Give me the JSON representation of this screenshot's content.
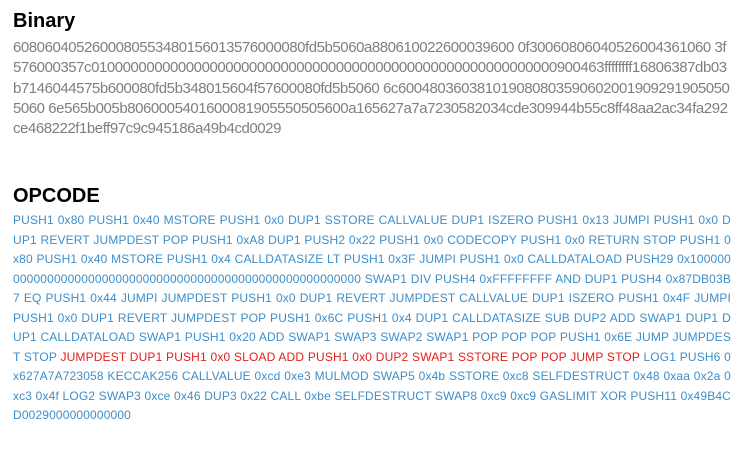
{
  "binary": {
    "heading": "Binary",
    "hex": "6080604052600080553480156013576000080fd5b5060a880610022600039600 0f30060806040526004361060 3f576000357c01000000000000000000000000000000000000000000000000000000000900463ffffffff16806387db03b7146044575b600080fd5b348015604f57600080fd5b5060 6c6004803603810190808035906020019092919050505060 6e565b005b8060005401600081905550505600a165627a7a7230582034cde309944b55c8ff48aa2ac34fa292ce468222f1beff97c9c945186a49b4cd0029"
  },
  "opcode": {
    "heading": "OPCODE",
    "segments": [
      {
        "style": "normal",
        "text": "PUSH1 0x80 PUSH1 0x40 MSTORE PUSH1 0x0 DUP1 SSTORE CALLVALUE DUP1 ISZERO PUSH1 0x13 JUMPI PUSH1 0x0 DUP1 REVERT JUMPDEST POP PUSH1 0xA8 DUP1 PUSH2 0x22 PUSH1 0x0 CODECOPY PUSH1 0x0 RETURN STOP PUSH1 0x80 PUSH1 0x40 MSTORE PUSH1 0x4 CALLDATASIZE LT PUSH1 0x3F JUMPI PUSH1 0x0 CALLDATALOAD PUSH29 0x100000000000000000000000000000000000000000000000000000000 SWAP1 DIV PUSH4 0xFFFFFFFF AND DUP1 PUSH4 0x87DB03B7 EQ PUSH1 0x44 JUMPI JUMPDEST PUSH1 0x0 DUP1 REVERT JUMPDEST CALLVALUE DUP1 ISZERO PUSH1 0x4F JUMPI PUSH1 0x0 DUP1 REVERT JUMPDEST POP PUSH1 0x6C PUSH1 0x4 DUP1 CALLDATASIZE SUB DUP2 ADD SWAP1 DUP1 DUP1 CALLDATALOAD SWAP1 PUSH1 0x20 ADD SWAP1 SWAP3 SWAP2 SWAP1 POP POP POP PUSH1 0x6E JUMP JUMPDEST STOP"
      },
      {
        "style": "highlight",
        "text": "JUMPDEST DUP1 PUSH1 0x0 SLOAD ADD PUSH1 0x0 DUP2 SWAP1 SSTORE POP POP JUMP STOP"
      },
      {
        "style": "normal",
        "text": "LOG1 PUSH6 0x627A7A723058 KECCAK256 CALLVALUE 0xcd 0xe3 MULMOD SWAP5 0x4b SSTORE 0xc8 SELFDESTRUCT 0x48 0xaa 0x2a 0xc3 0x4f LOG2 SWAP3 0xce 0x46 DUP3 0x22 CALL 0xbe SELFDESTRUCT SWAP8 0xc9 0xc9 GASLIMIT XOR PUSH11 0x49B4CD0029000000000000"
      }
    ],
    "colors": {
      "normal": "#3d8ec9",
      "highlight": "#e3201b"
    }
  }
}
